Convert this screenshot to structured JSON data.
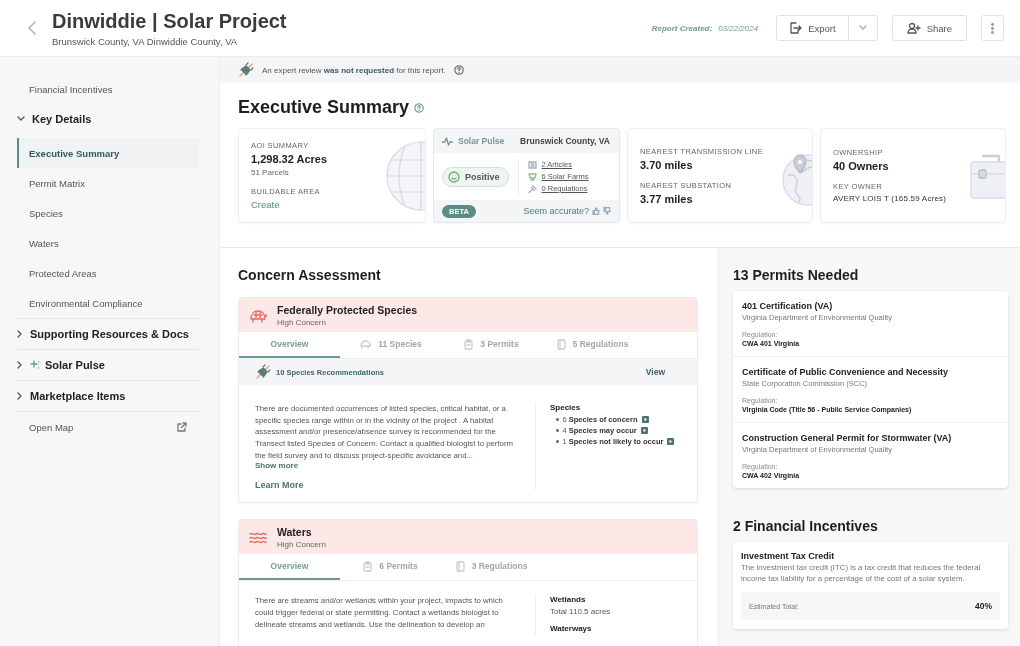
{
  "header": {
    "title": "Dinwiddie | Solar Project",
    "subtitle": "Brunswick County, VA Dinwiddie County, VA",
    "report_created_label": "Report Created:",
    "report_created_date": "03/22/2024",
    "export_label": "Export",
    "share_label": "Share"
  },
  "sidebar": {
    "items": [
      {
        "kind": "link",
        "label": "Financial Incentives",
        "selected": false
      },
      {
        "kind": "group",
        "label": "Key Details",
        "expanded": true,
        "selected": false,
        "children": [
          {
            "label": "Executive Summary",
            "selected": true
          },
          {
            "label": "Permit Matrix",
            "selected": false
          },
          {
            "label": "Species",
            "selected": false
          },
          {
            "label": "Waters",
            "selected": false
          },
          {
            "label": "Protected Areas",
            "selected": false
          },
          {
            "label": "Environmental Compliance",
            "selected": false
          }
        ]
      },
      {
        "kind": "group",
        "label": "Supporting Resources & Docs",
        "expanded": false,
        "selected": false
      },
      {
        "kind": "ai-group",
        "label": "Solar Pulse",
        "expanded": false,
        "selected": false
      },
      {
        "kind": "group",
        "label": "Marketplace Items",
        "expanded": false,
        "selected": false
      },
      {
        "kind": "external",
        "label": "Open Map",
        "selected": false
      }
    ]
  },
  "banner": {
    "text": "An expert review **was not requested** for this report."
  },
  "summary": {
    "title": "Executive Summary",
    "aoi": {
      "label": "AOI SUMMARY",
      "value": "1,298.32 Acres",
      "sub": "51 Parcels",
      "buildable_label": "BUILDABLE AREA",
      "buildable_link": "Create"
    },
    "solar_pulse": {
      "title": "Solar Pulse",
      "location": "Brunswick County, VA",
      "sentiment": "Positive",
      "links": [
        {
          "kind": "articles",
          "label": "2 Articles"
        },
        {
          "kind": "farms",
          "label": "6 Solar Farms"
        },
        {
          "kind": "regulations",
          "label": "0 Regulations"
        }
      ],
      "badge": "BETA",
      "feedback": "Seem accurate?"
    },
    "distances": [
      {
        "label": "NEAREST TRANSMISSION LINE",
        "value": "3.70 miles"
      },
      {
        "label": "NEAREST SUBSTATION",
        "value": "3.77 miles"
      }
    ],
    "ownership": {
      "label": "OWNERSHIP",
      "value": "40 Owners",
      "key_label": "KEY OWNER",
      "key_value": "AVERY LOIS T (165.59 Acres)"
    }
  },
  "concerns": {
    "title": "Concern Assessment",
    "items": [
      {
        "kind": "species",
        "title": "Federally Protected Species",
        "concern": "High Concern",
        "tabs": [
          {
            "kind": "overview",
            "label": "Overview",
            "selected": true
          },
          {
            "kind": "species",
            "label": "11 Species",
            "selected": false
          },
          {
            "kind": "permits",
            "label": "3 Permits",
            "selected": false
          },
          {
            "kind": "regulations",
            "label": "5 Regulations",
            "selected": false
          }
        ],
        "recommendation": {
          "text": "10 Species Recommendations",
          "action": "View"
        },
        "description": "There are documented occurrences of listed species, critical habitat, or a specific species range within or in the vicinity of the project . A habitat assessment and/or presence/absence survey is recommended for the Transect listed Species of Concern. Contact a qualified biologist to perform the field survey and to discuss project-specific avoidance and...",
        "show_more": "Show more",
        "learn_more": "Learn More",
        "side": [
          {
            "heading": "Species",
            "bullets": [
              "6 **Species of concern**",
              "4 **Species may occur**",
              "1 **Species not likely to occur**"
            ]
          }
        ]
      },
      {
        "kind": "waters",
        "title": "Waters",
        "concern": "High Concern",
        "tabs": [
          {
            "kind": "overview",
            "label": "Overview",
            "selected": true
          },
          {
            "kind": "permits",
            "label": "6 Permits",
            "selected": false
          },
          {
            "kind": "regulations",
            "label": "3 Regulations",
            "selected": false
          }
        ],
        "description": "There are streams and/or wetlands within your project, impacts to which could trigger federal or state permitting. Contact a wetlands biologist to delineate streams and wetlands. Use the delineation to develop an",
        "side": [
          {
            "heading": "Wetlands",
            "value": "Total 110.5 acres"
          },
          {
            "heading": "Waterways"
          }
        ]
      }
    ]
  },
  "permits": {
    "title": "13 Permits Needed",
    "items": [
      {
        "name": "401 Certification (VA)",
        "agency": "Virginia Department of Environmental Quality",
        "regulation_label": "Regulation:",
        "regulation": "CWA 401 Virginia"
      },
      {
        "name": "Certificate of Public Convenience and Necessity",
        "agency": "State Corporation Commission (SCC)",
        "regulation_label": "Regulation:",
        "regulation": "Virginia Code (Title 56 - Public Service Companies)"
      },
      {
        "name": "Construction General Permit for Stormwater (VA)",
        "agency": "Virginia Department of Environmental Quality",
        "regulation_label": "Regulation:",
        "regulation": "CWA 402 Virginia"
      }
    ]
  },
  "incentives": {
    "title": "2 Financial Incentives",
    "items": [
      {
        "name": "Investment Tax Credit",
        "description": "The investment tax credit (ITC) is a tax credit that reduces the federal income tax liability for a percentage of the cost of a solar system.",
        "total_label": "Estimated Total:",
        "total": "40%"
      }
    ]
  }
}
